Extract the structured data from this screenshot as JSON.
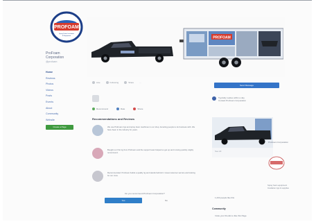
{
  "brand": {
    "name": "ProFoam Corporation",
    "name_line1": "ProFoam",
    "name_line2": "Corporation",
    "handle": "@profoam",
    "logo_text": "PROFOAM",
    "logo_tagline": "Spray Foam Insulation & Equipment"
  },
  "nav": {
    "items": [
      {
        "label": "Home",
        "active": true
      },
      {
        "label": "Reviews",
        "active": false
      },
      {
        "label": "Photos",
        "active": false
      },
      {
        "label": "Videos",
        "active": false
      },
      {
        "label": "Posts",
        "active": false
      },
      {
        "label": "Events",
        "active": false
      },
      {
        "label": "About",
        "active": false
      },
      {
        "label": "Community",
        "active": false
      },
      {
        "label": "Website",
        "active": false
      }
    ],
    "cta_label": "Create a Page"
  },
  "actions": {
    "like": "Like",
    "following": "Following",
    "share": "Share",
    "more": "..."
  },
  "post_actions": {
    "recommend": "Recommend",
    "rate": "Rate",
    "share": "Share"
  },
  "reviews": {
    "title": "Recommendations and Reviews",
    "items": [
      {
        "text": "We use ProFoam rigs and spray foam machines in our shop. Amazing people to do business with. We have been in the industry for years.",
        "avatar_color": "#b8c6d8"
      },
      {
        "text": "Bought our first rig from ProFoam and the support team helped us get up and running quickly. Highly recommend.",
        "avatar_color": "#d8a8b8"
      },
      {
        "text": "Recommended. ProFoam builds a quality rig and stands behind it. Great customer service and training for our crew.",
        "avatar_color": "#c7c7cf"
      }
    ],
    "question": "Do you recommend ProFoam Corporation?",
    "yes": "Yes",
    "no": "No"
  },
  "right": {
    "send_button": "Send Message",
    "reply_line1": "Typically replies within a day",
    "reply_line2": "Contact ProFoam Corporation",
    "promo_label": "See All",
    "promo_badge": "ProFoam Corporation",
    "side_text_1": "Spray foam equipment",
    "side_text_2": "Insulation rigs & supplies",
    "likes_line": "1,234 people like this",
    "communities_title": "Community",
    "communities_line": "Invite your friends to like this Page"
  },
  "colors": {
    "accent_blue": "#3474c8",
    "facebook_blue": "#3f63a8",
    "green": "#3f9a3f",
    "truck_black": "#1f2328"
  },
  "icons": {
    "like": "thumbs-up-icon",
    "share": "share-arrow-icon",
    "message": "chat-bubble-icon",
    "facebook": "facebook-icon"
  }
}
